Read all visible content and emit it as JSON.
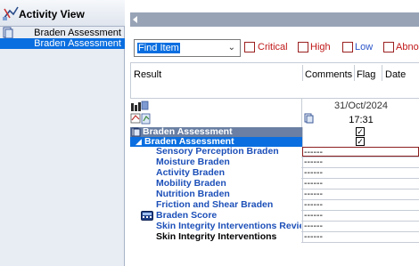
{
  "left_panel": {
    "title": "Activity View",
    "items": [
      {
        "label": "Braden Assessment",
        "selected": false
      },
      {
        "label": "Braden Assessment",
        "selected": true
      }
    ]
  },
  "filter": {
    "find_item": "Find Item",
    "checkboxes": [
      {
        "label": "Critical",
        "color": "#c01818",
        "checked": false
      },
      {
        "label": "High",
        "color": "#c01818",
        "checked": false
      },
      {
        "label": "Low",
        "color": "#2b55c9",
        "checked": false
      },
      {
        "label": "Abno",
        "color": "#c01818",
        "checked": false
      }
    ]
  },
  "columns": {
    "result": "Result",
    "comments": "Comments",
    "flag": "Flag",
    "date": "Date"
  },
  "grid": {
    "date": "31/Oct/2024",
    "time": "17:31",
    "rows": [
      {
        "label": "Braden Assessment",
        "value": "",
        "style": "section",
        "checked": true
      },
      {
        "label": "Braden Assessment",
        "value": "",
        "style": "selected",
        "checked": true
      },
      {
        "label": "Sensory Perception Braden",
        "value": "------",
        "style": "blue"
      },
      {
        "label": "Moisture Braden",
        "value": "------",
        "style": "blue"
      },
      {
        "label": "Activity Braden",
        "value": "------",
        "style": "blue"
      },
      {
        "label": "Mobility Braden",
        "value": "------",
        "style": "blue"
      },
      {
        "label": "Nutrition Braden",
        "value": "------",
        "style": "blue"
      },
      {
        "label": "Friction and Shear Braden",
        "value": "------",
        "style": "blue"
      },
      {
        "label": "Braden Score",
        "value": "------",
        "style": "blue"
      },
      {
        "label": "Skin Integrity Interventions Revie...",
        "value": "------",
        "style": "blue"
      },
      {
        "label": "Skin Integrity Interventions",
        "value": "------",
        "style": "plain"
      }
    ]
  },
  "colors": {
    "accent": "#0a6ee0",
    "section_bg": "#6a7fa3",
    "left_bg": "#e8ecf3"
  }
}
